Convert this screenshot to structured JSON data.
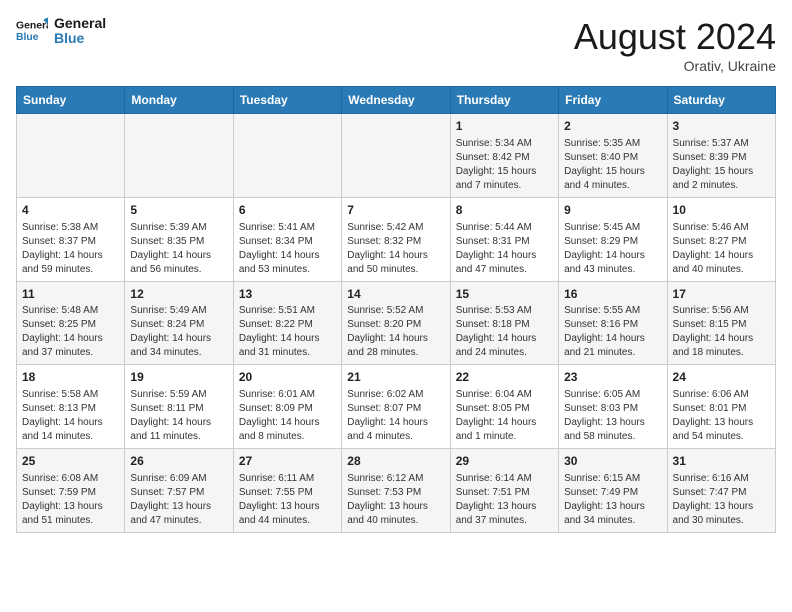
{
  "header": {
    "logo_text_general": "General",
    "logo_text_blue": "Blue",
    "month_title": "August 2024",
    "subtitle": "Orativ, Ukraine"
  },
  "days_of_week": [
    "Sunday",
    "Monday",
    "Tuesday",
    "Wednesday",
    "Thursday",
    "Friday",
    "Saturday"
  ],
  "weeks": [
    [
      {
        "day": "",
        "info": ""
      },
      {
        "day": "",
        "info": ""
      },
      {
        "day": "",
        "info": ""
      },
      {
        "day": "",
        "info": ""
      },
      {
        "day": "1",
        "info": "Sunrise: 5:34 AM\nSunset: 8:42 PM\nDaylight: 15 hours\nand 7 minutes."
      },
      {
        "day": "2",
        "info": "Sunrise: 5:35 AM\nSunset: 8:40 PM\nDaylight: 15 hours\nand 4 minutes."
      },
      {
        "day": "3",
        "info": "Sunrise: 5:37 AM\nSunset: 8:39 PM\nDaylight: 15 hours\nand 2 minutes."
      }
    ],
    [
      {
        "day": "4",
        "info": "Sunrise: 5:38 AM\nSunset: 8:37 PM\nDaylight: 14 hours\nand 59 minutes."
      },
      {
        "day": "5",
        "info": "Sunrise: 5:39 AM\nSunset: 8:35 PM\nDaylight: 14 hours\nand 56 minutes."
      },
      {
        "day": "6",
        "info": "Sunrise: 5:41 AM\nSunset: 8:34 PM\nDaylight: 14 hours\nand 53 minutes."
      },
      {
        "day": "7",
        "info": "Sunrise: 5:42 AM\nSunset: 8:32 PM\nDaylight: 14 hours\nand 50 minutes."
      },
      {
        "day": "8",
        "info": "Sunrise: 5:44 AM\nSunset: 8:31 PM\nDaylight: 14 hours\nand 47 minutes."
      },
      {
        "day": "9",
        "info": "Sunrise: 5:45 AM\nSunset: 8:29 PM\nDaylight: 14 hours\nand 43 minutes."
      },
      {
        "day": "10",
        "info": "Sunrise: 5:46 AM\nSunset: 8:27 PM\nDaylight: 14 hours\nand 40 minutes."
      }
    ],
    [
      {
        "day": "11",
        "info": "Sunrise: 5:48 AM\nSunset: 8:25 PM\nDaylight: 14 hours\nand 37 minutes."
      },
      {
        "day": "12",
        "info": "Sunrise: 5:49 AM\nSunset: 8:24 PM\nDaylight: 14 hours\nand 34 minutes."
      },
      {
        "day": "13",
        "info": "Sunrise: 5:51 AM\nSunset: 8:22 PM\nDaylight: 14 hours\nand 31 minutes."
      },
      {
        "day": "14",
        "info": "Sunrise: 5:52 AM\nSunset: 8:20 PM\nDaylight: 14 hours\nand 28 minutes."
      },
      {
        "day": "15",
        "info": "Sunrise: 5:53 AM\nSunset: 8:18 PM\nDaylight: 14 hours\nand 24 minutes."
      },
      {
        "day": "16",
        "info": "Sunrise: 5:55 AM\nSunset: 8:16 PM\nDaylight: 14 hours\nand 21 minutes."
      },
      {
        "day": "17",
        "info": "Sunrise: 5:56 AM\nSunset: 8:15 PM\nDaylight: 14 hours\nand 18 minutes."
      }
    ],
    [
      {
        "day": "18",
        "info": "Sunrise: 5:58 AM\nSunset: 8:13 PM\nDaylight: 14 hours\nand 14 minutes."
      },
      {
        "day": "19",
        "info": "Sunrise: 5:59 AM\nSunset: 8:11 PM\nDaylight: 14 hours\nand 11 minutes."
      },
      {
        "day": "20",
        "info": "Sunrise: 6:01 AM\nSunset: 8:09 PM\nDaylight: 14 hours\nand 8 minutes."
      },
      {
        "day": "21",
        "info": "Sunrise: 6:02 AM\nSunset: 8:07 PM\nDaylight: 14 hours\nand 4 minutes."
      },
      {
        "day": "22",
        "info": "Sunrise: 6:04 AM\nSunset: 8:05 PM\nDaylight: 14 hours\nand 1 minute."
      },
      {
        "day": "23",
        "info": "Sunrise: 6:05 AM\nSunset: 8:03 PM\nDaylight: 13 hours\nand 58 minutes."
      },
      {
        "day": "24",
        "info": "Sunrise: 6:06 AM\nSunset: 8:01 PM\nDaylight: 13 hours\nand 54 minutes."
      }
    ],
    [
      {
        "day": "25",
        "info": "Sunrise: 6:08 AM\nSunset: 7:59 PM\nDaylight: 13 hours\nand 51 minutes."
      },
      {
        "day": "26",
        "info": "Sunrise: 6:09 AM\nSunset: 7:57 PM\nDaylight: 13 hours\nand 47 minutes."
      },
      {
        "day": "27",
        "info": "Sunrise: 6:11 AM\nSunset: 7:55 PM\nDaylight: 13 hours\nand 44 minutes."
      },
      {
        "day": "28",
        "info": "Sunrise: 6:12 AM\nSunset: 7:53 PM\nDaylight: 13 hours\nand 40 minutes."
      },
      {
        "day": "29",
        "info": "Sunrise: 6:14 AM\nSunset: 7:51 PM\nDaylight: 13 hours\nand 37 minutes."
      },
      {
        "day": "30",
        "info": "Sunrise: 6:15 AM\nSunset: 7:49 PM\nDaylight: 13 hours\nand 34 minutes."
      },
      {
        "day": "31",
        "info": "Sunrise: 6:16 AM\nSunset: 7:47 PM\nDaylight: 13 hours\nand 30 minutes."
      }
    ]
  ]
}
